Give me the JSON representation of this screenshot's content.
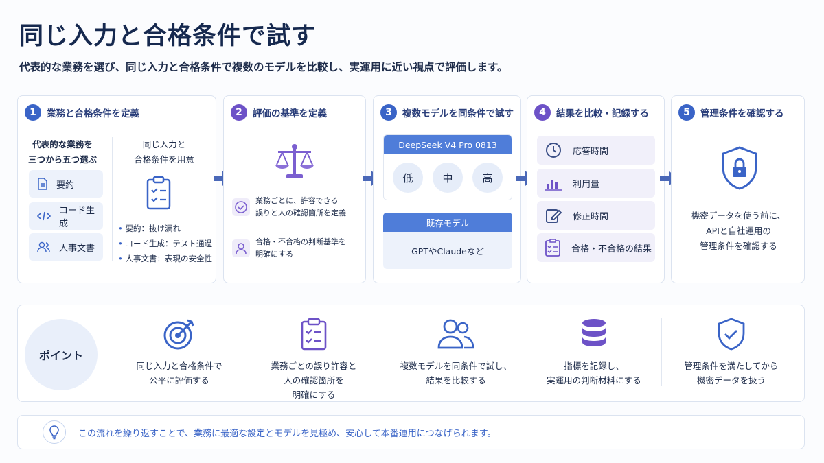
{
  "title": "同じ入力と合格条件で試す",
  "subtitle": "代表的な業務を選び、同じ入力と合格条件で複数のモデルを比較し、実運用に近い視点で評価します。",
  "colors": {
    "accent": "#3a64c7",
    "purple": "#6d52c7",
    "navy": "#16294f"
  },
  "steps": [
    {
      "num": "1",
      "title": "業務と合格条件を定義",
      "left_heading_1": "代表的な業務を",
      "left_heading_2": "三つから五つ選ぶ",
      "tasks": [
        {
          "label": "要約",
          "icon": "document-icon"
        },
        {
          "label": "コード生成",
          "icon": "code-icon"
        },
        {
          "label": "人事文書",
          "icon": "people-icon"
        }
      ],
      "right_heading_1": "同じ入力と",
      "right_heading_2": "合格条件を用意",
      "bullets": [
        "要約：抜け漏れ",
        "コード生成：テスト通過",
        "人事文書：表現の安全性"
      ]
    },
    {
      "num": "2",
      "title": "評価の基準を定義",
      "item1_line1": "業務ごとに、許容できる",
      "item1_line2": "誤りと人の確認箇所を定義",
      "item2_line1": "合格・不合格の判断基準を",
      "item2_line2": "明確にする"
    },
    {
      "num": "3",
      "title": "複数モデルを同条件で試す",
      "model_label": "DeepSeek V4 Pro 0813",
      "levels": [
        "低",
        "中",
        "高"
      ],
      "existing_label": "既存モデル",
      "existing_text": "GPTやClaudeなど"
    },
    {
      "num": "4",
      "title": "結果を比較・記録する",
      "items": [
        {
          "label": "応答時間",
          "icon": "clock-icon"
        },
        {
          "label": "利用量",
          "icon": "bar-chart-icon"
        },
        {
          "label": "修正時間",
          "icon": "edit-icon"
        },
        {
          "label": "合格・不合格の結果",
          "icon": "checklist-icon"
        }
      ]
    },
    {
      "num": "5",
      "title": "管理条件を確認する",
      "text_1": "機密データを使う前に、",
      "text_2": "APIと自社運用の",
      "text_3": "管理条件を確認する"
    }
  ],
  "point": {
    "label": "ポイント",
    "items": [
      {
        "line1": "同じ入力と合格条件で",
        "line2": "公平に評価する",
        "line3": "",
        "icon": "target-icon"
      },
      {
        "line1": "業務ごとの誤り許容と",
        "line2": "人の確認箇所を",
        "line3": "明確にする",
        "icon": "clipboard-icon"
      },
      {
        "line1": "複数モデルを同条件で試し、",
        "line2": "結果を比較する",
        "line3": "",
        "icon": "users-icon"
      },
      {
        "line1": "指標を記録し、",
        "line2": "実運用の判断材料にする",
        "line3": "",
        "icon": "database-icon"
      },
      {
        "line1": "管理条件を満たしてから",
        "line2": "機密データを扱う",
        "line3": "",
        "icon": "shield-check-icon"
      }
    ]
  },
  "footer": "この流れを繰り返すことで、業務に最適な設定とモデルを見極め、安心して本番運用につなげられます。"
}
